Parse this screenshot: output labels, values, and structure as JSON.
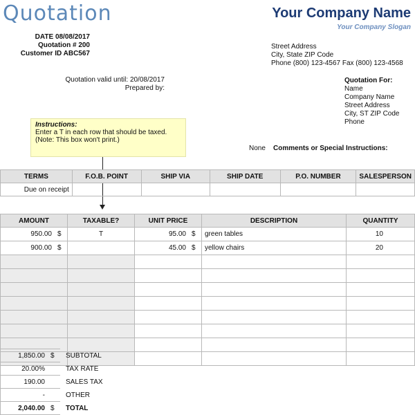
{
  "header": {
    "logo_text": "Quotation",
    "company_name": "Your Company Name",
    "slogan": "Your Company Slogan"
  },
  "meta": {
    "date_label": "DATE",
    "date_value": "08/08/2017",
    "quote_label": "Quotation #",
    "quote_value": "200",
    "customer_label": "Customer ID",
    "customer_value": "ABC567",
    "valid_label": "Quotation valid until:",
    "valid_value": "20/08/2017",
    "prepared_label": "Prepared by:"
  },
  "sender": {
    "street": "Street Address",
    "city": "City, State ZIP Code",
    "phone": "Phone (800) 123-4567   Fax (800) 123-4568"
  },
  "quote_for": {
    "heading": "Quotation For:",
    "name": "Name",
    "company": "Company Name",
    "street": "Street Address",
    "city": "City, ST  ZIP Code",
    "phone": "Phone"
  },
  "comments": {
    "label": "Comments or Special Instructions:",
    "value": "None"
  },
  "instructions": {
    "title": "Instructions:",
    "body": "Enter a T in each row that should be taxed.  (Note: This box won't print.)"
  },
  "ship_table": {
    "headers": [
      "SALESPERSON",
      "P.O. NUMBER",
      "SHIP DATE",
      "SHIP VIA",
      "F.O.B. POINT",
      "TERMS"
    ],
    "row": [
      "",
      "",
      "",
      "",
      "",
      "Due on receipt"
    ]
  },
  "items_table": {
    "headers": [
      "QUANTITY",
      "DESCRIPTION",
      "UNIT PRICE",
      "TAXABLE?",
      "AMOUNT"
    ],
    "rows": [
      {
        "qty": "10",
        "desc": "green tables",
        "cur1": "$",
        "unit": "95.00",
        "tax": "T",
        "cur2": "$",
        "amount": "950.00"
      },
      {
        "qty": "20",
        "desc": "yellow chairs",
        "cur1": "$",
        "unit": "45.00",
        "tax": "",
        "cur2": "$",
        "amount": "900.00"
      }
    ]
  },
  "totals": {
    "subtotal_label": "SUBTOTAL",
    "subtotal_cur": "$",
    "subtotal": "1,850.00",
    "taxrate_label": "TAX RATE",
    "taxrate": "20.00%",
    "salestax_label": "SALES TAX",
    "salestax": "190.00",
    "other_label": "OTHER",
    "other": "-",
    "total_label": "TOTAL",
    "total_cur": "$",
    "total": "2,040.00"
  }
}
